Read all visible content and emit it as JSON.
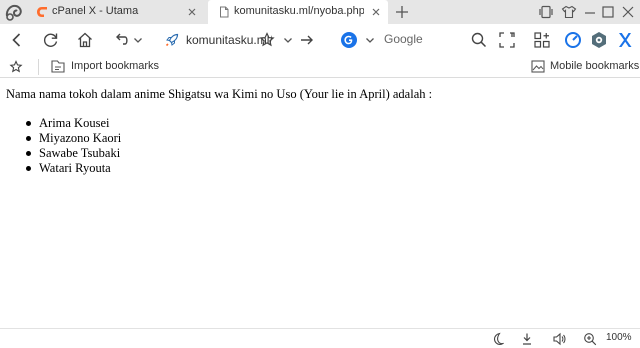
{
  "tabs": [
    {
      "title": "cPanel X - Utama"
    },
    {
      "title": "komunitasku.ml/nyoba.php"
    }
  ],
  "address_bar": {
    "url": "komunitasku.ml/nyoba.php",
    "search_placeholder": "Google"
  },
  "bookmarks_bar": {
    "import_label": "Import bookmarks",
    "mobile_label": "Mobile bookmarks"
  },
  "page": {
    "intro": "Nama nama tokoh dalam anime Shigatsu wa Kimi no Uso (Your lie in April) adalah :",
    "characters": [
      "Arima Kousei",
      "Miyazono Kaori",
      "Sawabe Tsubaki",
      "Watari Ryouta"
    ]
  },
  "status_bar": {
    "zoom": "100%"
  },
  "colors": {
    "tabstrip_bg": "#e6e6e6",
    "cpanel_orange": "#ff6c2c",
    "accent_blue": "#1a73e8",
    "extension_blue": "#2b6cb0"
  },
  "icons": [
    "uc-browser-logo-icon",
    "cpanel-favicon-icon",
    "page-favicon-icon",
    "tab-close-icon",
    "new-tab-icon",
    "tablet-mode-icon",
    "skin-icon",
    "minimize-icon",
    "maximize-icon",
    "window-close-icon",
    "back-icon",
    "reload-icon",
    "home-icon",
    "undo-icon",
    "chevron-down-icon",
    "rocket-icon",
    "star-icon",
    "go-arrow-icon",
    "search-engine-icon",
    "search-icon",
    "screenshot-icon",
    "extensions-icon",
    "speed-dial-icon",
    "vpn-icon",
    "x-icon",
    "import-bookmarks-icon",
    "mobile-bookmarks-icon",
    "night-mode-icon",
    "download-icon",
    "volume-icon",
    "zoom-icon"
  ]
}
